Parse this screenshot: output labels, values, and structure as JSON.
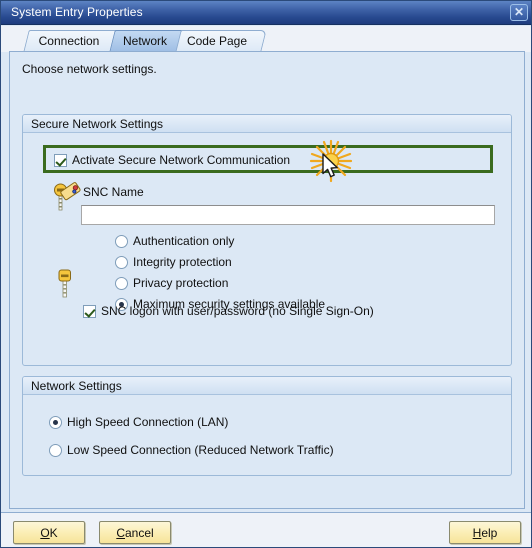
{
  "window": {
    "title": "System Entry Properties",
    "close_label": "✕"
  },
  "tabs": [
    {
      "label": "Connection",
      "selected": false
    },
    {
      "label": "Network",
      "selected": true
    },
    {
      "label": "Code Page",
      "selected": false
    }
  ],
  "page": {
    "intro": "Choose network settings."
  },
  "secure_network_settings": {
    "group_title": "Secure Network Settings",
    "activate": {
      "label": "Activate Secure Network Communication",
      "checked": true,
      "highlighted": true
    },
    "snc_name": {
      "label": "SNC Name",
      "value": "",
      "placeholder": ""
    },
    "protection_options": [
      {
        "label": "Authentication only",
        "selected": false
      },
      {
        "label": "Integrity protection",
        "selected": false
      },
      {
        "label": "Privacy protection",
        "selected": false
      },
      {
        "label": "Maximum security settings available",
        "selected": true
      }
    ],
    "snc_logon": {
      "label": "SNC logon with user/password (no Single Sign-On)",
      "checked": true
    }
  },
  "network_settings": {
    "group_title": "Network Settings",
    "options": [
      {
        "label": "High Speed Connection (LAN)",
        "selected": true
      },
      {
        "label": "Low Speed Connection (Reduced Network Traffic)",
        "selected": false
      }
    ]
  },
  "footer": {
    "ok": {
      "prefix": "",
      "accel": "O",
      "suffix": "K"
    },
    "cancel": {
      "prefix": "",
      "accel": "C",
      "suffix": "ancel"
    },
    "help": {
      "prefix": "",
      "accel": "H",
      "suffix": "elp"
    }
  },
  "colors": {
    "titlebar_start": "#5d84c4",
    "titlebar_end": "#1e3c7e",
    "page_background": "#dce8f5",
    "highlight_border": "#3a6b1e",
    "button_face": "#fbeeb4",
    "key_icon": "#f5c53d"
  }
}
